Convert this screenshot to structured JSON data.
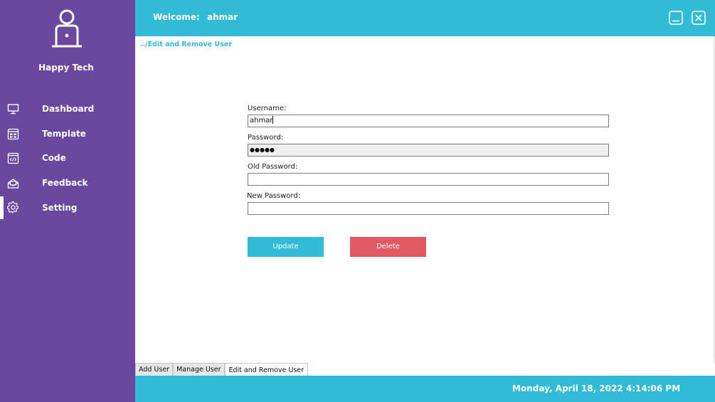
{
  "brand": {
    "name": "Happy Tech",
    "logo_icon": "user-laptop-icon"
  },
  "sidebar": {
    "items": [
      {
        "label": "Dashboard",
        "icon": "monitor-icon"
      },
      {
        "label": "Template",
        "icon": "template-icon"
      },
      {
        "label": "Code",
        "icon": "code-icon"
      },
      {
        "label": "Feedback",
        "icon": "feedback-icon"
      },
      {
        "label": "Setting",
        "icon": "gear-icon",
        "active": true
      }
    ]
  },
  "header": {
    "welcome_label": "Welcome:",
    "username": "ahmar"
  },
  "breadcrumb": "../Edit and Remove User",
  "form": {
    "username_label": "Username:",
    "username_value": "ahmar",
    "password_label": "Password:",
    "password_value": "●●●●●",
    "old_password_label": "Old Password:",
    "old_password_value": "",
    "new_password_label": "New Password:",
    "new_password_value": ""
  },
  "buttons": {
    "update": "Update",
    "delete": "Delete"
  },
  "tabs": [
    {
      "label": "Add User"
    },
    {
      "label": "Manage User"
    },
    {
      "label": "Edit and Remove User",
      "active": true
    }
  ],
  "footer": {
    "datetime": "Monday, April 18, 2022 4:14:06 PM"
  },
  "colors": {
    "sidebar": "#6a48a0",
    "accent": "#31bbd6",
    "delete": "#e05a64"
  }
}
